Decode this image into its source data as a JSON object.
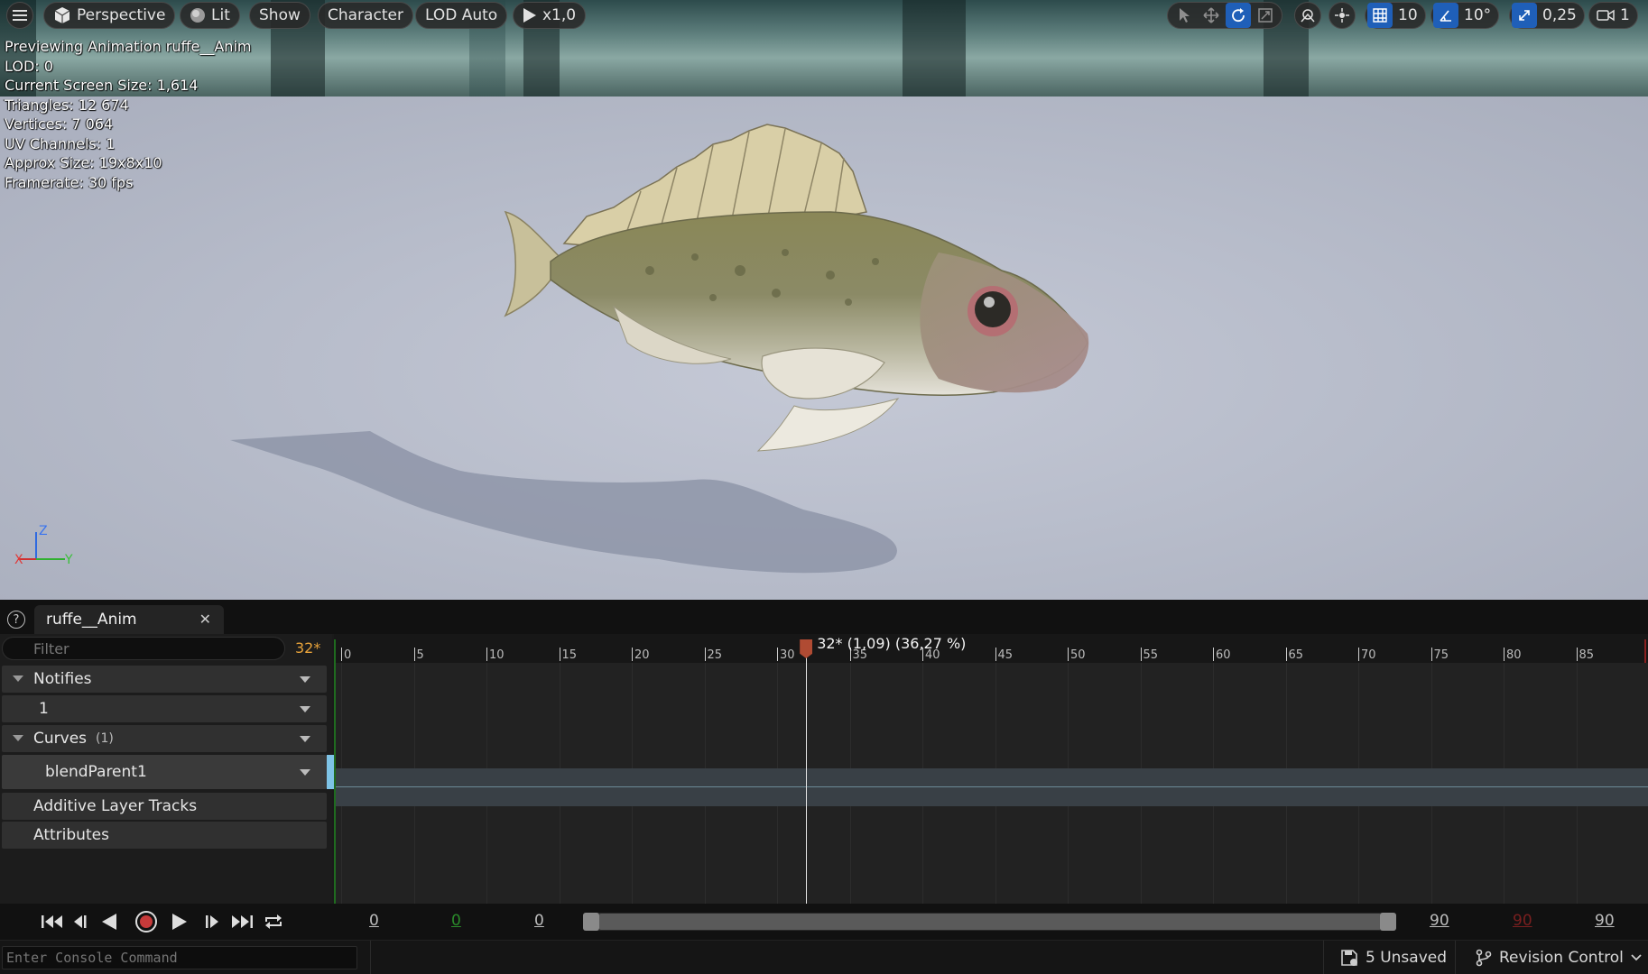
{
  "toolbar": {
    "viewport_mode": "Perspective",
    "lighting": "Lit",
    "show": "Show",
    "character": "Character",
    "lod": "LOD Auto",
    "play_speed": "x1,0",
    "grid_snap_value": "10",
    "rotation_snap_value": "10°",
    "scale_snap_value": "0,25",
    "camera_speed": "1"
  },
  "stats": {
    "previewing": "Previewing Animation ruffe__Anim",
    "lod": "LOD: 0",
    "screen_size": "Current Screen Size: 1,614",
    "triangles": "Triangles: 12 674",
    "vertices": "Vertices: 7 064",
    "uv_channels": "UV Channels: 1",
    "approx_size": "Approx Size: 19x8x10",
    "framerate": "Framerate: 30 fps"
  },
  "gizmo": {
    "z": "Z",
    "x": "X",
    "y": "Y"
  },
  "editor": {
    "tab_title": "ruffe__Anim",
    "filter_placeholder": "Filter",
    "current_frame": "32*",
    "rows": {
      "notifies": "Notifies",
      "notify_track": "1",
      "curves": "Curves",
      "curves_count": "(1)",
      "curve_name": "blendParent1",
      "additive": "Additive Layer Tracks",
      "attributes": "Attributes"
    },
    "playhead_label": "32* (1,09) (36,27 %)",
    "ruler_ticks": [
      "0",
      "5",
      "10",
      "15",
      "20",
      "25",
      "30",
      "35",
      "40",
      "45",
      "50",
      "55",
      "60",
      "65",
      "70",
      "75",
      "80",
      "85"
    ],
    "playhead_frame": 32,
    "total_frames": 90
  },
  "transport": {
    "start_a": "0",
    "start_b": "0",
    "start_c": "0",
    "end_a": "90",
    "end_b": "90",
    "end_c": "90"
  },
  "status": {
    "console_placeholder": "Enter Console Command",
    "unsaved": "5 Unsaved",
    "revision": "Revision Control"
  },
  "colors": {
    "accent_blue": "#1f62c6",
    "frame_orange": "#e8a33a",
    "playhead_red": "#b04b33",
    "start_green": "#2a8a2a",
    "end_red": "#8a2020"
  }
}
